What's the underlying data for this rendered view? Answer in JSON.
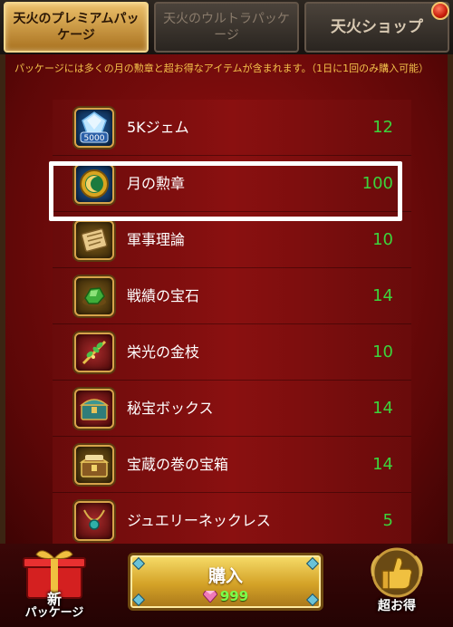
{
  "tabs": [
    {
      "label": "天火のプレミアムパッケージ",
      "state": "active"
    },
    {
      "label": "天火のウルトラパッケージ",
      "state": "inactive"
    },
    {
      "label": "天火ショップ",
      "state": "inactive"
    }
  ],
  "description": "パッケージには多くの月の勲章と超お得なアイテムが含まれます。（1日に1回のみ購入可能）",
  "items": [
    {
      "name": "5Kジェム",
      "qty": "12",
      "icon": "gem-chest-icon",
      "badge": "5000"
    },
    {
      "name": "月の勲章",
      "qty": "100",
      "icon": "moon-medal-icon"
    },
    {
      "name": "軍事理論",
      "qty": "10",
      "icon": "scroll-icon"
    },
    {
      "name": "戦績の宝石",
      "qty": "14",
      "icon": "green-gem-icon"
    },
    {
      "name": "栄光の金枝",
      "qty": "10",
      "icon": "golden-branch-icon"
    },
    {
      "name": "秘宝ボックス",
      "qty": "14",
      "icon": "treasure-box-icon"
    },
    {
      "name": "宝蔵の巻の宝箱",
      "qty": "14",
      "icon": "scroll-chest-icon"
    },
    {
      "name": "ジュエリーネックレス",
      "qty": "5",
      "icon": "necklace-icon"
    }
  ],
  "selected_index": 1,
  "buy": {
    "label": "購入",
    "price": "999",
    "currency_icon": "diamond-icon"
  },
  "new_package": {
    "line1": "新",
    "line2": "パッケージ"
  },
  "deal": {
    "label": "超お得"
  },
  "colors": {
    "quantity": "#3cd43c",
    "description": "#f3c24b",
    "price": "#7dff4a"
  }
}
